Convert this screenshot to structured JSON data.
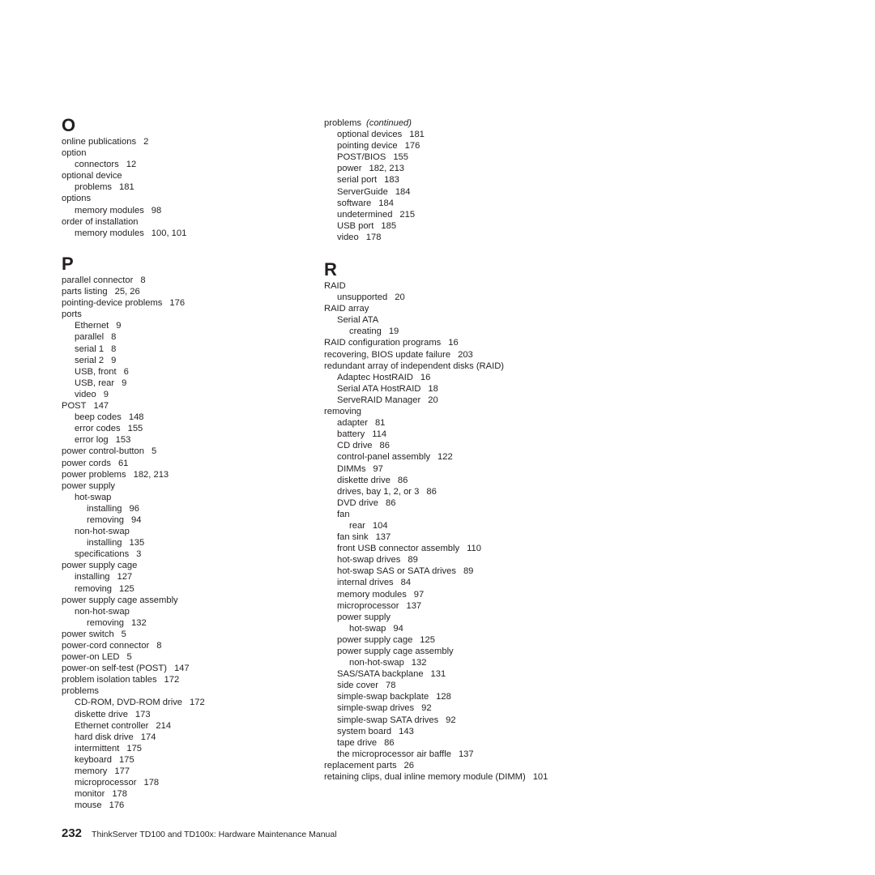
{
  "sections": {
    "O": {
      "letter": "O",
      "entries": [
        {
          "level": 0,
          "text": "online publications",
          "pages": "2"
        },
        {
          "level": 0,
          "text": "option",
          "pages": ""
        },
        {
          "level": 1,
          "text": "connectors",
          "pages": "12"
        },
        {
          "level": 0,
          "text": "optional device",
          "pages": ""
        },
        {
          "level": 1,
          "text": "problems",
          "pages": "181"
        },
        {
          "level": 0,
          "text": "options",
          "pages": ""
        },
        {
          "level": 1,
          "text": "memory modules",
          "pages": "98"
        },
        {
          "level": 0,
          "text": "order of installation",
          "pages": ""
        },
        {
          "level": 1,
          "text": "memory modules",
          "pages": "100, 101"
        }
      ]
    },
    "P": {
      "letter": "P",
      "entries": [
        {
          "level": 0,
          "text": "parallel connector",
          "pages": "8"
        },
        {
          "level": 0,
          "text": "parts listing",
          "pages": "25, 26"
        },
        {
          "level": 0,
          "text": "pointing-device problems",
          "pages": "176"
        },
        {
          "level": 0,
          "text": "ports",
          "pages": ""
        },
        {
          "level": 1,
          "text": "Ethernet",
          "pages": "9"
        },
        {
          "level": 1,
          "text": "parallel",
          "pages": "8"
        },
        {
          "level": 1,
          "text": "serial 1",
          "pages": "8"
        },
        {
          "level": 1,
          "text": "serial 2",
          "pages": "9"
        },
        {
          "level": 1,
          "text": "USB, front",
          "pages": "6"
        },
        {
          "level": 1,
          "text": "USB, rear",
          "pages": "9"
        },
        {
          "level": 1,
          "text": "video",
          "pages": "9"
        },
        {
          "level": 0,
          "text": "POST",
          "pages": "147"
        },
        {
          "level": 1,
          "text": "beep codes",
          "pages": "148"
        },
        {
          "level": 1,
          "text": "error codes",
          "pages": "155"
        },
        {
          "level": 1,
          "text": "error log",
          "pages": "153"
        },
        {
          "level": 0,
          "text": "power control-button",
          "pages": "5"
        },
        {
          "level": 0,
          "text": "power cords",
          "pages": "61"
        },
        {
          "level": 0,
          "text": "power problems",
          "pages": "182, 213"
        },
        {
          "level": 0,
          "text": "power supply",
          "pages": ""
        },
        {
          "level": 1,
          "text": "hot-swap",
          "pages": ""
        },
        {
          "level": 2,
          "text": "installing",
          "pages": "96"
        },
        {
          "level": 2,
          "text": "removing",
          "pages": "94"
        },
        {
          "level": 1,
          "text": "non-hot-swap",
          "pages": ""
        },
        {
          "level": 2,
          "text": "installing",
          "pages": "135"
        },
        {
          "level": 1,
          "text": "specifications",
          "pages": "3"
        },
        {
          "level": 0,
          "text": "power supply cage",
          "pages": ""
        },
        {
          "level": 1,
          "text": "installing",
          "pages": "127"
        },
        {
          "level": 1,
          "text": "removing",
          "pages": "125"
        },
        {
          "level": 0,
          "text": "power supply cage assembly",
          "pages": ""
        },
        {
          "level": 1,
          "text": "non-hot-swap",
          "pages": ""
        },
        {
          "level": 2,
          "text": "removing",
          "pages": "132"
        },
        {
          "level": 0,
          "text": "power switch",
          "pages": "5"
        },
        {
          "level": 0,
          "text": "power-cord connector",
          "pages": "8"
        },
        {
          "level": 0,
          "text": "power-on LED",
          "pages": "5"
        },
        {
          "level": 0,
          "text": "power-on self-test (POST)",
          "pages": "147"
        },
        {
          "level": 0,
          "text": "problem isolation tables",
          "pages": "172"
        },
        {
          "level": 0,
          "text": "problems",
          "pages": ""
        },
        {
          "level": 1,
          "text": "CD-ROM, DVD-ROM drive",
          "pages": "172"
        },
        {
          "level": 1,
          "text": "diskette drive",
          "pages": "173"
        },
        {
          "level": 1,
          "text": "Ethernet controller",
          "pages": "214"
        },
        {
          "level": 1,
          "text": "hard disk drive",
          "pages": "174"
        },
        {
          "level": 1,
          "text": "intermittent",
          "pages": "175"
        },
        {
          "level": 1,
          "text": "keyboard",
          "pages": "175"
        },
        {
          "level": 1,
          "text": "memory",
          "pages": "177"
        },
        {
          "level": 1,
          "text": "microprocessor",
          "pages": "178"
        },
        {
          "level": 1,
          "text": "monitor",
          "pages": "178"
        },
        {
          "level": 1,
          "text": "mouse",
          "pages": "176"
        }
      ]
    },
    "P_continued": {
      "heading": "problems",
      "continued_label": "(continued)",
      "entries": [
        {
          "level": 1,
          "text": "optional devices",
          "pages": "181"
        },
        {
          "level": 1,
          "text": "pointing device",
          "pages": "176"
        },
        {
          "level": 1,
          "text": "POST/BIOS",
          "pages": "155"
        },
        {
          "level": 1,
          "text": "power",
          "pages": "182, 213"
        },
        {
          "level": 1,
          "text": "serial port",
          "pages": "183"
        },
        {
          "level": 1,
          "text": "ServerGuide",
          "pages": "184"
        },
        {
          "level": 1,
          "text": "software",
          "pages": "184"
        },
        {
          "level": 1,
          "text": "undetermined",
          "pages": "215"
        },
        {
          "level": 1,
          "text": "USB port",
          "pages": "185"
        },
        {
          "level": 1,
          "text": "video",
          "pages": "178"
        }
      ]
    },
    "R": {
      "letter": "R",
      "entries": [
        {
          "level": 0,
          "text": "RAID",
          "pages": ""
        },
        {
          "level": 1,
          "text": "unsupported",
          "pages": "20"
        },
        {
          "level": 0,
          "text": "RAID array",
          "pages": ""
        },
        {
          "level": 1,
          "text": "Serial ATA",
          "pages": ""
        },
        {
          "level": 2,
          "text": "creating",
          "pages": "19"
        },
        {
          "level": 0,
          "text": "RAID configuration programs",
          "pages": "16"
        },
        {
          "level": 0,
          "text": "recovering, BIOS update failure",
          "pages": "203"
        },
        {
          "level": 0,
          "text": "redundant array of independent disks (RAID)",
          "pages": ""
        },
        {
          "level": 1,
          "text": "Adaptec HostRAID",
          "pages": "16"
        },
        {
          "level": 1,
          "text": "Serial ATA HostRAID",
          "pages": "18"
        },
        {
          "level": 1,
          "text": "ServeRAID Manager",
          "pages": "20"
        },
        {
          "level": 0,
          "text": "removing",
          "pages": ""
        },
        {
          "level": 1,
          "text": "adapter",
          "pages": "81"
        },
        {
          "level": 1,
          "text": "battery",
          "pages": "114"
        },
        {
          "level": 1,
          "text": "CD drive",
          "pages": "86"
        },
        {
          "level": 1,
          "text": "control-panel assembly",
          "pages": "122"
        },
        {
          "level": 1,
          "text": "DIMMs",
          "pages": "97"
        },
        {
          "level": 1,
          "text": "diskette drive",
          "pages": "86"
        },
        {
          "level": 1,
          "text": "drives, bay 1, 2, or 3",
          "pages": "86"
        },
        {
          "level": 1,
          "text": "DVD drive",
          "pages": "86"
        },
        {
          "level": 1,
          "text": "fan",
          "pages": ""
        },
        {
          "level": 2,
          "text": "rear",
          "pages": "104"
        },
        {
          "level": 1,
          "text": "fan sink",
          "pages": "137"
        },
        {
          "level": 1,
          "text": "front USB connector assembly",
          "pages": "110"
        },
        {
          "level": 1,
          "text": "hot-swap drives",
          "pages": "89"
        },
        {
          "level": 1,
          "text": "hot-swap SAS or SATA drives",
          "pages": "89"
        },
        {
          "level": 1,
          "text": "internal drives",
          "pages": "84"
        },
        {
          "level": 1,
          "text": "memory modules",
          "pages": "97"
        },
        {
          "level": 1,
          "text": "microprocessor",
          "pages": "137"
        },
        {
          "level": 1,
          "text": "power supply",
          "pages": ""
        },
        {
          "level": 2,
          "text": "hot-swap",
          "pages": "94"
        },
        {
          "level": 1,
          "text": "power supply cage",
          "pages": "125"
        },
        {
          "level": 1,
          "text": "power supply cage assembly",
          "pages": ""
        },
        {
          "level": 2,
          "text": "non-hot-swap",
          "pages": "132"
        },
        {
          "level": 1,
          "text": "SAS/SATA backplane",
          "pages": "131"
        },
        {
          "level": 1,
          "text": "side cover",
          "pages": "78"
        },
        {
          "level": 1,
          "text": "simple-swap backplate",
          "pages": "128"
        },
        {
          "level": 1,
          "text": "simple-swap drives",
          "pages": "92"
        },
        {
          "level": 1,
          "text": "simple-swap SATA drives",
          "pages": "92"
        },
        {
          "level": 1,
          "text": "system board",
          "pages": "143"
        },
        {
          "level": 1,
          "text": "tape drive",
          "pages": "86"
        },
        {
          "level": 1,
          "text": "the microprocessor air baffle",
          "pages": "137"
        },
        {
          "level": 0,
          "text": "replacement parts",
          "pages": "26"
        },
        {
          "level": 0,
          "text": "retaining clips, dual inline memory module (DIMM)",
          "pages": "101"
        }
      ]
    }
  },
  "footer": {
    "page_number": "232",
    "book_title": "ThinkServer TD100 and TD100x:  Hardware Maintenance Manual"
  }
}
